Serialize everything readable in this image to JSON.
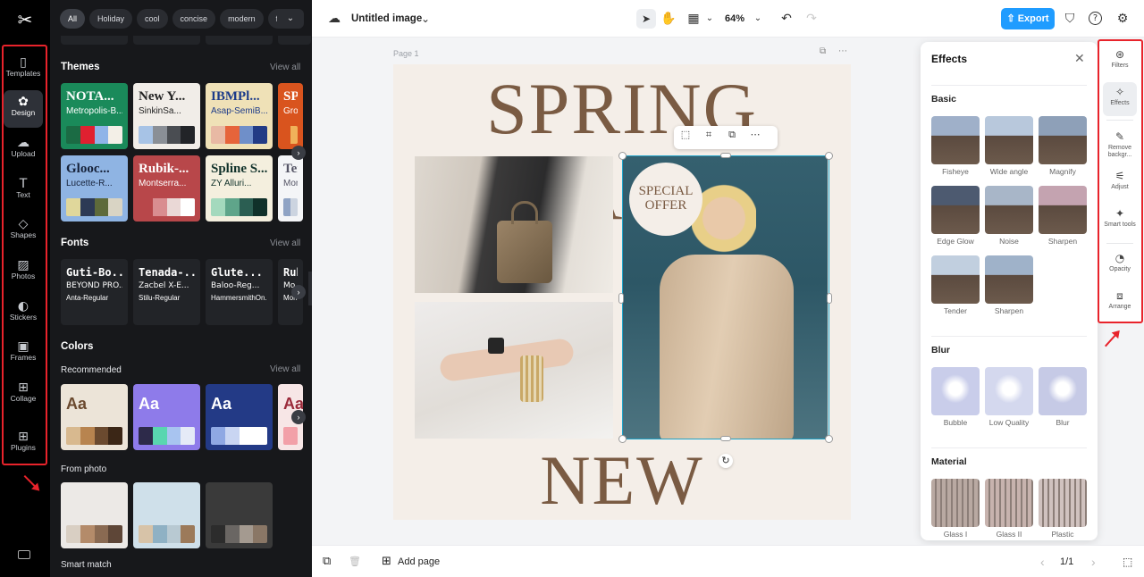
{
  "app": {
    "logo_glyph": "✂"
  },
  "rail": {
    "items": [
      {
        "label": "Templates",
        "icon": "▯"
      },
      {
        "label": "Design",
        "icon": "✿"
      },
      {
        "label": "Upload",
        "icon": "☁"
      },
      {
        "label": "Text",
        "icon": "T"
      },
      {
        "label": "Shapes",
        "icon": "◇"
      },
      {
        "label": "Photos",
        "icon": "▨"
      },
      {
        "label": "Stickers",
        "icon": "◐"
      },
      {
        "label": "Frames",
        "icon": "▣"
      },
      {
        "label": "Collage",
        "icon": "⊞"
      },
      {
        "label": "Plugins",
        "icon": "⊞"
      }
    ]
  },
  "panel": {
    "chips": [
      "All",
      "Holiday",
      "cool",
      "concise",
      "modern",
      "form"
    ],
    "chips_more": "⌄",
    "themes": {
      "title": "Themes",
      "view_all": "View all",
      "cards": [
        {
          "t1": "NOTA...",
          "t2": "Metropolis-B...",
          "bg": "#1a8a5a",
          "fg": "#ffffff",
          "colors": [
            "#1b6b44",
            "#e02030",
            "#8fb4e8",
            "#f3efe7"
          ]
        },
        {
          "t1": "New Y...",
          "t2": "SinkinSa...",
          "bg": "#f1ede8",
          "fg": "#222222",
          "colors": [
            "#a7c3e6",
            "#8a8f96",
            "#4a4d52",
            "#222428"
          ]
        },
        {
          "t1": "IBMPl...",
          "t2": "Asap-SemiB...",
          "bg": "#efe1b7",
          "fg": "#1c3b8a",
          "colors": [
            "#e8b9a4",
            "#e6643b",
            "#6f8fc9",
            "#223b85"
          ]
        },
        {
          "t1": "SP",
          "t2": "Grotes",
          "bg": "#d9541e",
          "fg": "#ffffff",
          "colors": [
            "#d9541e",
            "#f0b25a"
          ]
        },
        {
          "t1": "Glooc...",
          "t2": "Lucette-R...",
          "bg": "#8fb4e3",
          "fg": "#16223a",
          "colors": [
            "#e0d79b",
            "#2d3a55",
            "#5e6a3a",
            "#d9d4c4"
          ]
        },
        {
          "t1": "Rubik-...",
          "t2": "Montserra...",
          "bg": "#b8474a",
          "fg": "#ffffff",
          "colors": [
            "#b8474a",
            "#d98d90",
            "#ead8d6",
            "#ffffff"
          ]
        },
        {
          "t1": "Spline S...",
          "t2": "ZY Alluri...",
          "bg": "#f4efde",
          "fg": "#10312a",
          "colors": [
            "#a4d9bd",
            "#5fa58a",
            "#2b5e52",
            "#10312a"
          ]
        },
        {
          "t1": "Ter",
          "t2": "Mon",
          "bg": "#f4f5f7",
          "fg": "#556",
          "colors": [
            "#8fa3c4",
            "#ccd4e0"
          ]
        }
      ]
    },
    "fonts": {
      "title": "Fonts",
      "view_all": "View all",
      "cards": [
        {
          "f1": "Guti-Bo...",
          "f2": "BEYOND PRO...",
          "f3": "Anta-Regular"
        },
        {
          "f1": "Tenada-...",
          "f2": "Zacbel X-E...",
          "f3": "Stilu-Regular"
        },
        {
          "f1": "Glute...",
          "f2": "Baloo-Reg...",
          "f3": "HammersmithOn..."
        },
        {
          "f1": "Rub",
          "f2": "Mo",
          "f3": "Montse"
        }
      ]
    },
    "colors": {
      "title": "Colors",
      "recommended": "Recommended",
      "view_all": "View all",
      "aa": "Aa",
      "cards": [
        {
          "bg": "#ece4d8",
          "fg": "#6b4a2f",
          "swatch": [
            "#d8b98f",
            "#b8844f",
            "#6b4a2f",
            "#3b2616"
          ]
        },
        {
          "bg": "#8e7bea",
          "fg": "#ffffff",
          "swatch": [
            "#2d2a4a",
            "#59d6b0",
            "#a8c4f0",
            "#e5eaf7"
          ]
        },
        {
          "bg": "#233a86",
          "fg": "#ffffff",
          "swatch": [
            "#8fa8e3",
            "#c9d5f2",
            "#ffffff",
            "#ffffff"
          ]
        },
        {
          "bg": "#f7e6e6",
          "fg": "#9b2a3a",
          "swatch": [
            "#f2a0a8"
          ]
        }
      ],
      "from_photo": "From photo",
      "photo_cards": [
        {
          "bg": "#ece9e6",
          "swatch": [
            "#d9cfc3",
            "#b48b6a",
            "#8a6a52",
            "#5e4637"
          ]
        },
        {
          "bg": "#cfe0ea",
          "swatch": [
            "#d7c3a8",
            "#8fb1c4",
            "#b8c9d2",
            "#9c7a5a"
          ]
        },
        {
          "bg": "#3a3a3a",
          "swatch": [
            "#2c2c2c",
            "#6a6663",
            "#a49a90",
            "#8a7766"
          ]
        }
      ],
      "smart_match": "Smart match"
    }
  },
  "topbar": {
    "cloud_icon": "☁",
    "doc_title": "Untitled image",
    "caret": "⌄",
    "select_icon": "➤",
    "hand_icon": "✋",
    "layout_icon": "▦",
    "zoom": "64%",
    "undo_icon": "↶",
    "redo_icon": "↷",
    "export_label": "Export",
    "export_icon": "⇧",
    "shield_icon": "⛉",
    "help_icon": "?",
    "settings_icon": "⚙"
  },
  "canvas": {
    "page_label": "Page 1",
    "headline_top": "SPRING SALE",
    "headline_bottom": "NEW ARRIVAL",
    "offer_line1": "SPECIAL",
    "offer_line2": "OFFER",
    "page_icons": [
      "⧉",
      "⋯"
    ],
    "float_icons": [
      "⬚",
      "⌗",
      "⧉",
      "⋯"
    ],
    "rotate_icon": "↻"
  },
  "effects": {
    "title": "Effects",
    "close_icon": "✕",
    "sections": [
      {
        "title": "Basic",
        "items": [
          "Fisheye",
          "Wide angle",
          "Magnify",
          "Edge Glow",
          "Noise",
          "Sharpen",
          "Tender",
          "Sharpen"
        ]
      },
      {
        "title": "Blur",
        "items": [
          "Bubble",
          "Low Quality",
          "Blur"
        ]
      },
      {
        "title": "Material",
        "items": [
          "Glass I",
          "Glass II",
          "Plastic"
        ]
      }
    ]
  },
  "right_rail": {
    "items": [
      {
        "label": "Filters",
        "icon": "⊛"
      },
      {
        "label": "Effects",
        "icon": "✧"
      },
      {
        "label": "Remove backgr...",
        "icon": "✎"
      },
      {
        "label": "Adjust",
        "icon": "⚟"
      },
      {
        "label": "Smart tools",
        "icon": "✦"
      },
      {
        "label": "Opacity",
        "icon": "◔"
      },
      {
        "label": "Arrange",
        "icon": "⧈"
      }
    ]
  },
  "bottombar": {
    "copy_icon": "⧉",
    "trash_icon": "🗑",
    "add_page": "Add page",
    "add_icon": "⊞",
    "prev_icon": "‹",
    "page_count": "1/1",
    "next_icon": "›",
    "expand_icon": "⬚"
  },
  "colors": {
    "accent": "#1f9cff",
    "annotation": "#e8232b",
    "selection": "#20a3c8"
  }
}
